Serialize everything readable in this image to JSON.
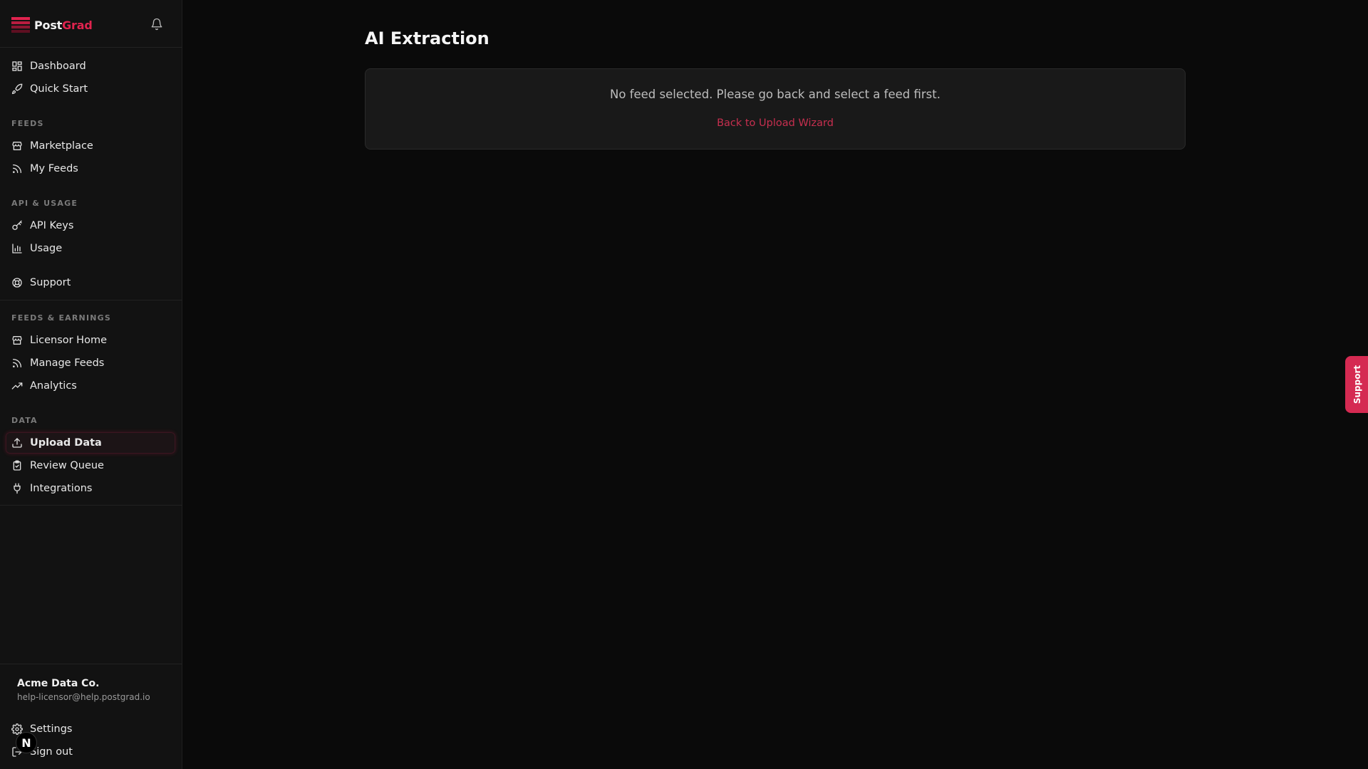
{
  "brand": {
    "name_part1": "Post",
    "name_part2": "Grad",
    "accent": "#e0234e"
  },
  "sidebar": {
    "top_items": [
      {
        "label": "Dashboard",
        "icon": "dashboard-icon"
      },
      {
        "label": "Quick Start",
        "icon": "rocket-icon"
      }
    ],
    "sections": [
      {
        "label": "FEEDS",
        "items": [
          {
            "label": "Marketplace",
            "icon": "store-icon"
          },
          {
            "label": "My Feeds",
            "icon": "rss-icon"
          }
        ]
      },
      {
        "label": "API & USAGE",
        "items": [
          {
            "label": "API Keys",
            "icon": "key-icon"
          },
          {
            "label": "Usage",
            "icon": "bar-chart-icon"
          }
        ]
      }
    ],
    "support": {
      "label": "Support",
      "icon": "lifebuoy-icon"
    },
    "sections2": [
      {
        "label": "FEEDS & EARNINGS",
        "items": [
          {
            "label": "Licensor Home",
            "icon": "store-icon"
          },
          {
            "label": "Manage Feeds",
            "icon": "rss-icon"
          },
          {
            "label": "Analytics",
            "icon": "trending-up-icon"
          }
        ]
      },
      {
        "label": "DATA",
        "items": [
          {
            "label": "Upload Data",
            "icon": "upload-icon",
            "active": true
          },
          {
            "label": "Review Queue",
            "icon": "clipboard-check-icon"
          },
          {
            "label": "Integrations",
            "icon": "plug-icon"
          }
        ]
      }
    ],
    "account": {
      "name": "Acme Data Co.",
      "email": "help-licensor@help.postgrad.io"
    },
    "footer_items": [
      {
        "label": "Settings",
        "icon": "gear-icon"
      },
      {
        "label": "Sign out",
        "icon": "sign-out-icon"
      }
    ],
    "avatar_letter": "N"
  },
  "main": {
    "title": "AI Extraction",
    "message": "No feed selected. Please go back and select a feed first.",
    "link_label": "Back to Upload Wizard"
  },
  "support_tab": {
    "label": "Support",
    "color": "#d52a52"
  }
}
